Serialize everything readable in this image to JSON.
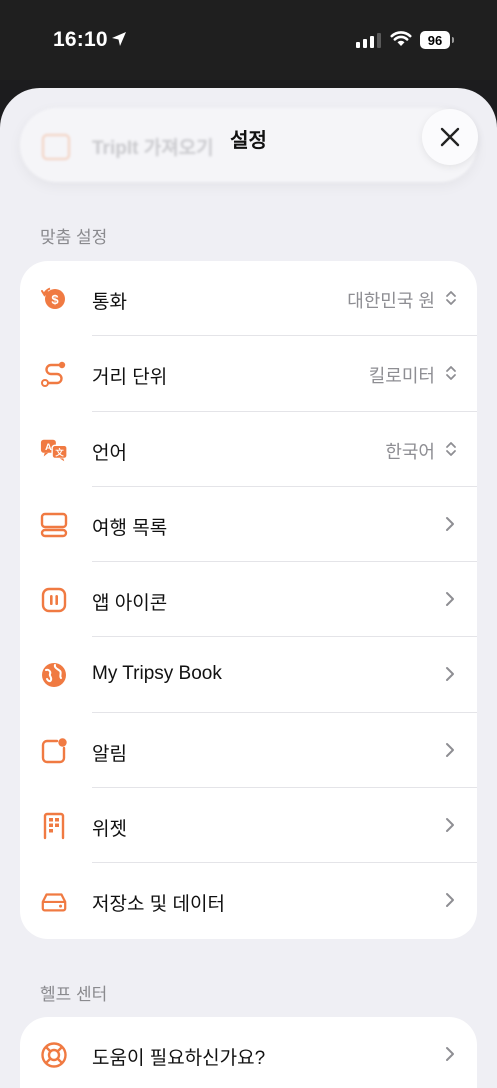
{
  "status": {
    "time": "16:10",
    "battery": "96"
  },
  "sheet": {
    "title": "설정",
    "behind_text": "TripIt 가져오기"
  },
  "sections": {
    "custom_header": "맞춤 설정",
    "help_header": "헬프 센터"
  },
  "rows": [
    {
      "label": "통화",
      "value": "대한민국 원",
      "icon": "currency-exchange-icon"
    },
    {
      "label": "거리 단위",
      "value": "킬로미터",
      "icon": "route-icon"
    },
    {
      "label": "언어",
      "value": "한국어",
      "icon": "translate-icon"
    },
    {
      "label": "여행 목록",
      "icon": "trip-list-icon"
    },
    {
      "label": "앱 아이콘",
      "icon": "app-icon-icon"
    },
    {
      "label": "My Tripsy Book",
      "icon": "globe-icon"
    },
    {
      "label": "알림",
      "icon": "notification-icon"
    },
    {
      "label": "위젯",
      "icon": "widget-icon"
    },
    {
      "label": "저장소 및 데이터",
      "icon": "storage-icon"
    }
  ],
  "help_rows": [
    {
      "label": "도움이 필요하신가요?",
      "icon": "lifebuoy-icon"
    }
  ],
  "colors": {
    "accent": "#f07a42",
    "background": "#efeff4"
  }
}
